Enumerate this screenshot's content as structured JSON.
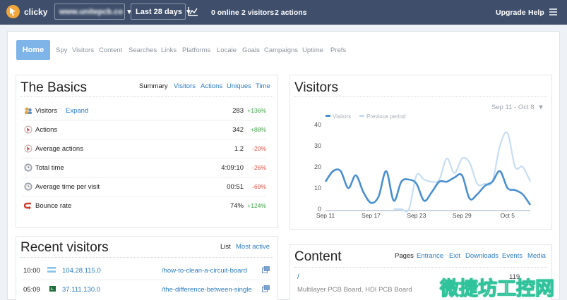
{
  "topbar": {
    "brand": "clicky",
    "site": "www.unitepcb.co",
    "range": "Last 28 days",
    "online": "0 online",
    "visitors": "2 visitors",
    "actions": "2 actions",
    "upgrade": "Upgrade",
    "help": "Help",
    "icons": [
      "clicky-logo-icon",
      "line-graph-icon",
      "menu-icon"
    ]
  },
  "nav": {
    "home": "Home",
    "items": [
      "Spy",
      "Visitors",
      "Content",
      "Searches",
      "Links",
      "Platforms",
      "Locale",
      "Goals",
      "Campaigns",
      "Uptime",
      "Prefs"
    ]
  },
  "basics": {
    "title": "The Basics",
    "tabs": [
      "Summary",
      "Visitors",
      "Actions",
      "Uniques",
      "Time"
    ],
    "rows": [
      {
        "label": "Visitors",
        "link": "Expand",
        "value": "283",
        "change": "+136%",
        "dir": "up"
      },
      {
        "label": "Actions",
        "link": "",
        "value": "342",
        "change": "+88%",
        "dir": "up"
      },
      {
        "label": "Average actions",
        "link": "",
        "value": "1.2",
        "change": "-20%",
        "dir": "down"
      },
      {
        "label": "Total time",
        "link": "",
        "value": "4:09:10",
        "change": "-26%",
        "dir": "down"
      },
      {
        "label": "Average time per visit",
        "link": "",
        "value": "00:51",
        "change": "-69%",
        "dir": "down"
      },
      {
        "label": "Bounce rate",
        "link": "",
        "value": "74%",
        "change": "+124%",
        "dir": "up"
      }
    ]
  },
  "visitors_chart": {
    "title": "Visitors",
    "range": "Sep 11 - Oct 8",
    "legend_current": "Visitors",
    "legend_previous": "Previous period",
    "colors": {
      "current": "#4a8fcf",
      "previous": "#c6def4"
    }
  },
  "chart_data": {
    "type": "line",
    "x": [
      "Sep 11",
      "Sep 12",
      "Sep 13",
      "Sep 14",
      "Sep 15",
      "Sep 16",
      "Sep 17",
      "Sep 18",
      "Sep 19",
      "Sep 20",
      "Sep 21",
      "Sep 22",
      "Sep 23",
      "Sep 24",
      "Sep 25",
      "Sep 26",
      "Sep 27",
      "Sep 28",
      "Sep 29",
      "Sep 30",
      "Oct 1",
      "Oct 2",
      "Oct 3",
      "Oct 4",
      "Oct 5",
      "Oct 6",
      "Oct 7",
      "Oct 8"
    ],
    "xticks": [
      "Sep 11",
      "Sep 17",
      "Sep 23",
      "Sep 29",
      "Oct 5"
    ],
    "ylim": [
      0,
      40
    ],
    "yticks": [
      0,
      10,
      20,
      30,
      40
    ],
    "series": [
      {
        "name": "Visitors",
        "values": [
          13,
          18,
          18,
          10,
          16,
          8,
          3,
          6,
          18,
          4,
          13,
          14,
          12,
          4,
          8,
          13,
          13,
          15,
          16,
          5,
          7,
          11,
          13,
          18,
          10,
          9,
          7,
          2
        ]
      },
      {
        "name": "Previous period",
        "values": [
          null,
          null,
          null,
          null,
          null,
          null,
          null,
          null,
          null,
          0,
          0,
          0,
          16,
          14,
          13,
          14,
          24,
          17,
          24,
          22,
          12,
          12,
          13,
          30,
          36,
          20,
          20,
          13
        ]
      }
    ],
    "grid": false,
    "legend": "top-left"
  },
  "recent": {
    "title": "Recent visitors",
    "tabs": [
      "List",
      "Most active"
    ],
    "rows": [
      {
        "time": "10:00",
        "ip": "104.28.115.0",
        "page": "/how-to-clean-a-circuit-board"
      },
      {
        "time": "05:09",
        "ip": "37.111.130.0",
        "page": "/the-difference-between-single"
      }
    ]
  },
  "content": {
    "title": "Content",
    "tabs": [
      "Pages",
      "Entrance",
      "Exit",
      "Downloads",
      "Events",
      "Media"
    ],
    "first_path": "/",
    "first_title": "Multilayer PCB Board, HDI PCB Board",
    "first_count": "119"
  },
  "watermark": "微捷坊工控网"
}
